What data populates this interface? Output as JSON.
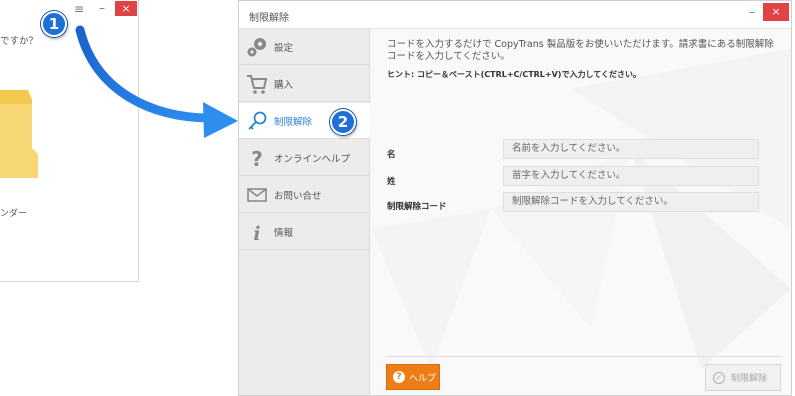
{
  "background_window": {
    "question_text": "ですか？",
    "folder_label": "ンダー",
    "menu_icon": "hamburger-icon",
    "minimize_label": "–",
    "close_label": "×",
    "folder_color": "#f7d774"
  },
  "badges": {
    "step1": "1",
    "step2": "2"
  },
  "dialog": {
    "title": "制限解除",
    "minimize_label": "–",
    "close_label": "×"
  },
  "sidebar": {
    "items": [
      {
        "label": "設定",
        "icon": "gears-icon"
      },
      {
        "label": "購入",
        "icon": "cart-icon"
      },
      {
        "label": "制限解除",
        "icon": "key-icon"
      },
      {
        "label": "オンラインヘルプ",
        "icon": "question-icon"
      },
      {
        "label": "お問い合せ",
        "icon": "envelope-icon"
      },
      {
        "label": "情報",
        "icon": "info-icon"
      }
    ],
    "active_index": 2
  },
  "content": {
    "description": "コードを入力するだけで CopyTrans 製品版をお使いいただけます。請求書にある制限解除コードを入力してください。",
    "hint": "ヒント: コピー＆ペースト(CTRL+C/CTRL+V)で入力してください。",
    "fields": [
      {
        "label": "名",
        "placeholder": "名前を入力してください。"
      },
      {
        "label": "姓",
        "placeholder": "苗字を入力してください。"
      },
      {
        "label": "制限解除コード",
        "placeholder": "制限解除コードを入力してください。"
      }
    ]
  },
  "footer": {
    "help_label": "ヘルプ",
    "unlock_label": "制限解除"
  },
  "colors": {
    "accent_blue": "#2a84d6",
    "help_orange": "#ee7d16",
    "close_red": "#e04343",
    "badge_blue": "#1f6fd6"
  }
}
